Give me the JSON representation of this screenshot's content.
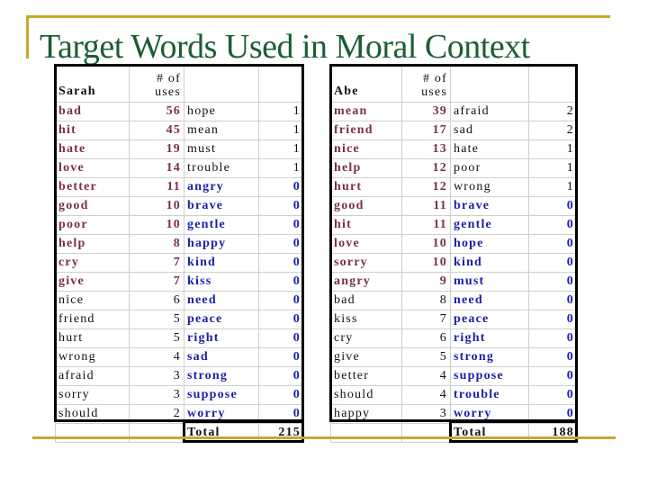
{
  "title": "Target Words Used in Moral Context",
  "colors": {
    "accent_gold": "#c8a632",
    "title_green": "#1a5e36",
    "frequent_word": "#7a2d52",
    "zero_word": "#1a1fa8"
  },
  "tables": [
    {
      "name": "Sarah",
      "uses_header": "# of uses",
      "left": [
        [
          "bad",
          56,
          "m"
        ],
        [
          "hit",
          45,
          "m"
        ],
        [
          "hate",
          19,
          "m"
        ],
        [
          "love",
          14,
          "m"
        ],
        [
          "better",
          11,
          "m"
        ],
        [
          "good",
          10,
          "m"
        ],
        [
          "poor",
          10,
          "m"
        ],
        [
          "help",
          8,
          "m"
        ],
        [
          "cry",
          7,
          "m"
        ],
        [
          "give",
          7,
          "m"
        ],
        [
          "nice",
          6,
          "k"
        ],
        [
          "friend",
          5,
          "k"
        ],
        [
          "hurt",
          5,
          "k"
        ],
        [
          "wrong",
          4,
          "k"
        ],
        [
          "afraid",
          3,
          "k"
        ],
        [
          "sorry",
          3,
          "k"
        ],
        [
          "should",
          2,
          "k"
        ]
      ],
      "right": [
        [
          "hope",
          1,
          "k"
        ],
        [
          "mean",
          1,
          "k"
        ],
        [
          "must",
          1,
          "k"
        ],
        [
          "trouble",
          1,
          "k"
        ],
        [
          "angry",
          0,
          "b"
        ],
        [
          "brave",
          0,
          "b"
        ],
        [
          "gentle",
          0,
          "b"
        ],
        [
          "happy",
          0,
          "b"
        ],
        [
          "kind",
          0,
          "b"
        ],
        [
          "kiss",
          0,
          "b"
        ],
        [
          "need",
          0,
          "b"
        ],
        [
          "peace",
          0,
          "b"
        ],
        [
          "right",
          0,
          "b"
        ],
        [
          "sad",
          0,
          "b"
        ],
        [
          "strong",
          0,
          "b"
        ],
        [
          "suppose",
          0,
          "b"
        ],
        [
          "worry",
          0,
          "b"
        ]
      ],
      "total_label": "Total",
      "total": "215"
    },
    {
      "name": "Abe",
      "uses_header": "# of uses",
      "left": [
        [
          "mean",
          39,
          "m"
        ],
        [
          "friend",
          17,
          "m"
        ],
        [
          "nice",
          13,
          "m"
        ],
        [
          "help",
          12,
          "m"
        ],
        [
          "hurt",
          12,
          "m"
        ],
        [
          "good",
          11,
          "m"
        ],
        [
          "hit",
          11,
          "m"
        ],
        [
          "love",
          10,
          "m"
        ],
        [
          "sorry",
          10,
          "m"
        ],
        [
          "angry",
          9,
          "m"
        ],
        [
          "bad",
          8,
          "k"
        ],
        [
          "kiss",
          7,
          "k"
        ],
        [
          "cry",
          6,
          "k"
        ],
        [
          "give",
          5,
          "k"
        ],
        [
          "better",
          4,
          "k"
        ],
        [
          "should",
          4,
          "k"
        ],
        [
          "happy",
          3,
          "k"
        ]
      ],
      "right": [
        [
          "afraid",
          2,
          "k"
        ],
        [
          "sad",
          2,
          "k"
        ],
        [
          "hate",
          1,
          "k"
        ],
        [
          "poor",
          1,
          "k"
        ],
        [
          "wrong",
          1,
          "k"
        ],
        [
          "brave",
          0,
          "b"
        ],
        [
          "gentle",
          0,
          "b"
        ],
        [
          "hope",
          0,
          "b"
        ],
        [
          "kind",
          0,
          "b"
        ],
        [
          "must",
          0,
          "b"
        ],
        [
          "need",
          0,
          "b"
        ],
        [
          "peace",
          0,
          "b"
        ],
        [
          "right",
          0,
          "b"
        ],
        [
          "strong",
          0,
          "b"
        ],
        [
          "suppose",
          0,
          "b"
        ],
        [
          "trouble",
          0,
          "b"
        ],
        [
          "worry",
          0,
          "b"
        ]
      ],
      "total_label": "Total",
      "total": "188"
    }
  ]
}
